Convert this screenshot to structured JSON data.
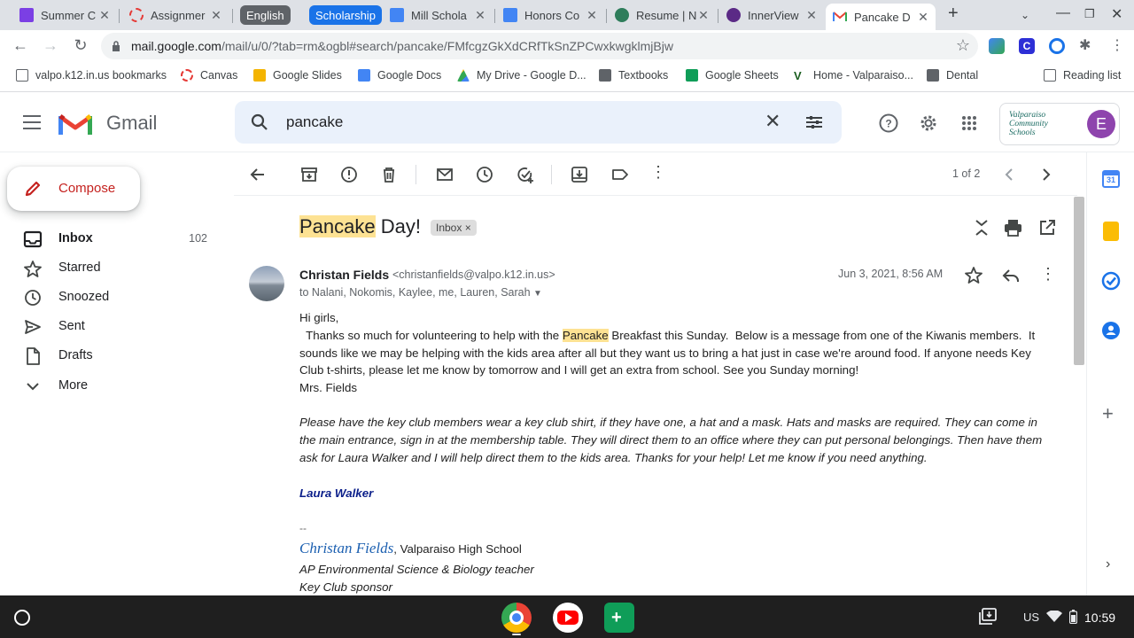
{
  "browser": {
    "tabs": [
      {
        "title": "Summer C",
        "color": "#7b3fe4"
      },
      {
        "title": "Assignmer",
        "color": "#e53935"
      },
      {
        "title": "Mill Schola",
        "color": "#4285f4"
      },
      {
        "title": "Honors Co",
        "color": "#4285f4"
      },
      {
        "title": "Resume | N",
        "color": "#2e7d5b"
      },
      {
        "title": "InnerView",
        "color": "#5b2a86"
      },
      {
        "title": "Pancake D",
        "color": "#ea4335"
      }
    ],
    "groups": [
      {
        "label": "English",
        "color": "#5f6368"
      },
      {
        "label": "Scholarship",
        "color": "#1a73e8"
      }
    ],
    "new_tab_glyph": "+",
    "url_host": "mail.google.com",
    "url_path": "/mail/u/0/?tab=rm&ogbl#search/pancake/FMfcgzGkXdCRfTkSnZPCwxkwgklmjBjw"
  },
  "bookmarks": [
    {
      "label": "valpo.k12.in.us bookmarks",
      "color": "#5f6368"
    },
    {
      "label": "Canvas",
      "color": "#e53935"
    },
    {
      "label": "Google Slides",
      "color": "#f4b400"
    },
    {
      "label": "Google Docs",
      "color": "#4285f4"
    },
    {
      "label": "My Drive - Google D...",
      "color": "#34a853"
    },
    {
      "label": "Textbooks",
      "color": "#5f6368"
    },
    {
      "label": "Google Sheets",
      "color": "#0f9d58"
    },
    {
      "label": "Home - Valparaiso...",
      "color": "#1b5e20"
    },
    {
      "label": "Dental",
      "color": "#5f6368"
    }
  ],
  "reading_list": "Reading list",
  "gmail": {
    "brand": "Gmail",
    "search_query": "pancake",
    "org_name": "Valparaiso Community Schools",
    "avatar_letter": "E",
    "compose": "Compose",
    "nav": [
      {
        "label": "Inbox",
        "count": "102"
      },
      {
        "label": "Starred",
        "count": ""
      },
      {
        "label": "Snoozed",
        "count": ""
      },
      {
        "label": "Sent",
        "count": ""
      },
      {
        "label": "Drafts",
        "count": ""
      },
      {
        "label": "More",
        "count": ""
      }
    ],
    "pager": "1 of 2"
  },
  "email": {
    "subject_highlight": "Pancake",
    "subject_rest": " Day!",
    "label_badge": "Inbox",
    "sender_name": "Christan Fields",
    "sender_email": "<christanfields@valpo.k12.in.us>",
    "recipients": "to Nalani, Nokomis, Kaylee, me, Lauren, Sarah",
    "date": "Jun 3, 2021, 8:56 AM",
    "greeting": "Hi girls,",
    "p1_a": "  Thanks so much for volunteering to help with the ",
    "p1_hl": "Pancake",
    "p1_b": " Breakfast this Sunday.  Below is a message from one of the Kiwanis members.  It",
    "p1_l2": "sounds like we may be helping with the kids area after all but they want us to bring a hat just in case we're around food.  If anyone needs Key",
    "p1_l3": "Club t-shirts, please let me know by tomorrow and I will get an extra from school.  See you Sunday morning!",
    "p1_sign": "Mrs. Fields",
    "q_l1": "Please have the key club members wear a key club shirt, if they have one, a hat and a mask.  Hats and masks are required. They can come in",
    "q_l2": "the main entrance, sign in at the membership table.  They will direct them to an office where they can put personal belongings. Then have them",
    "q_l3": "ask for Laura Walker and I will help direct them to the kids area. Thanks for your help! Let me know if you need anything.",
    "q_sig": "Laura Walker",
    "sig_sep": "--",
    "sig_name": "Christan Fields",
    "sig_school": ", Valparaiso High School",
    "sig_title": "AP Environmental Science & Biology teacher",
    "sig_role": "Key Club sponsor"
  },
  "shelf": {
    "ime": "US",
    "time": "10:59"
  }
}
